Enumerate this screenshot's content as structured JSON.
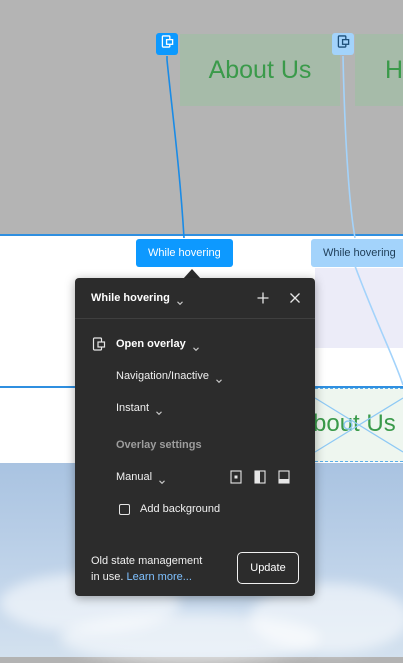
{
  "canvas": {
    "card_about_label": "About Us",
    "card_partial_label": "H",
    "lower_about_label": "bout Us"
  },
  "triggers": {
    "active_label": "While hovering",
    "secondary_label": "While hovering"
  },
  "panel": {
    "title": "While hovering",
    "action": "Open overlay",
    "destination": "Navigation/Inactive",
    "animation": "Instant",
    "overlay_section": "Overlay settings",
    "overlay_position": "Manual",
    "add_background_label": "Add background",
    "add_background_checked": false,
    "footer_text_line1": "Old state management",
    "footer_text_line2": "in use.",
    "learn_more_label": "Learn more...",
    "update_label": "Update"
  },
  "colors": {
    "accent_blue": "#0d99ff",
    "light_blue": "#a3d3fb",
    "panel_bg": "#2c2c2c",
    "card_text_green": "#3a9a4a"
  },
  "icons": {
    "prototype_pin": "device-icon",
    "add": "plus-icon",
    "close": "close-icon"
  }
}
